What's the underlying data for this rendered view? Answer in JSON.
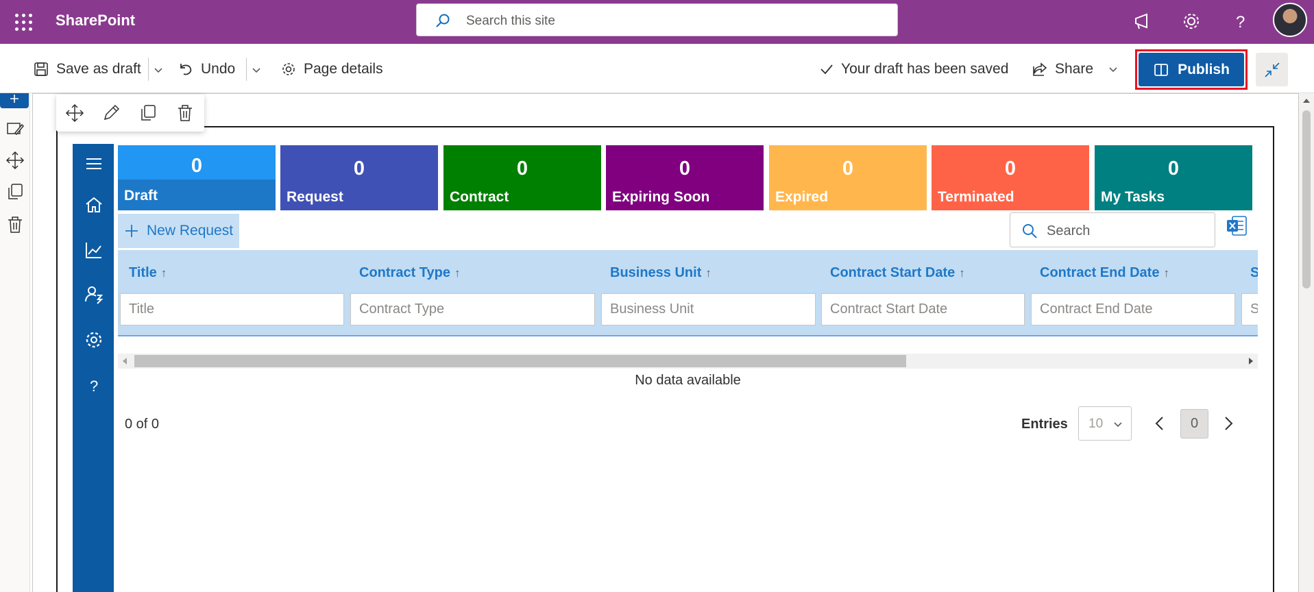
{
  "suitebar": {
    "brand": "SharePoint",
    "search_placeholder": "Search this site",
    "icons": [
      "app-launcher-icon",
      "megaphone-icon",
      "gear-icon",
      "help-icon"
    ]
  },
  "commandbar": {
    "save_draft": "Save as draft",
    "undo": "Undo",
    "page_details": "Page details",
    "status": "Your draft has been saved",
    "share": "Share",
    "publish": "Publish"
  },
  "tiles": [
    {
      "count": "0",
      "label": "Draft",
      "color": "#2196f3"
    },
    {
      "count": "0",
      "label": "Request",
      "color": "#3f51b5"
    },
    {
      "count": "0",
      "label": "Contract",
      "color": "#008000"
    },
    {
      "count": "0",
      "label": "Expiring Soon",
      "color": "#800080"
    },
    {
      "count": "0",
      "label": "Expired",
      "color": "#ffb74d"
    },
    {
      "count": "0",
      "label": "Terminated",
      "color": "#ff6347"
    },
    {
      "count": "0",
      "label": "My Tasks",
      "color": "#008080"
    }
  ],
  "grid": {
    "new_request": "New Request",
    "search_placeholder": "Search",
    "columns": [
      {
        "header": "Title",
        "arrow": "↑",
        "filter_placeholder": "Title"
      },
      {
        "header": "Contract Type",
        "arrow": "↑",
        "filter_placeholder": "Contract Type"
      },
      {
        "header": "Business Unit",
        "arrow": "↑",
        "filter_placeholder": "Business Unit"
      },
      {
        "header": "Contract Start Date",
        "arrow": "↑",
        "filter_placeholder": "Contract Start Date"
      },
      {
        "header": "Contract End Date",
        "arrow": "↑",
        "filter_placeholder": "Contract End Date"
      },
      {
        "header": "S",
        "arrow": "",
        "filter_placeholder": "S"
      }
    ],
    "empty_message": "No data available",
    "record_count": "0 of 0",
    "entries_label": "Entries",
    "entries_value": "10",
    "current_page": "0"
  },
  "colors": {
    "suitebar": "#8a3a8e",
    "accent": "#1e78c8",
    "app_nav": "#0b5aa2",
    "publish": "#0f5ba6",
    "highlight": "#e81123"
  }
}
